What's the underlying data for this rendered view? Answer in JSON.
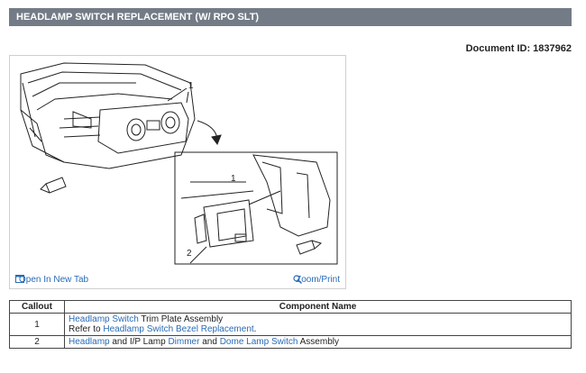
{
  "header": {
    "title": "HEADLAMP SWITCH REPLACEMENT (W/ RPO SLT)"
  },
  "document": {
    "id_label": "Document ID:",
    "id_value": "1837962"
  },
  "figure": {
    "callout_1": "1",
    "callout_inset_1": "1",
    "callout_inset_2": "2",
    "open_tab_label": "Open In New Tab",
    "zoom_label": "Zoom/Print",
    "open_tab_icon": "open-tab-icon",
    "zoom_icon": "magnifier-icon"
  },
  "table": {
    "headers": {
      "callout": "Callout",
      "component": "Component Name"
    },
    "rows": [
      {
        "callout": "1",
        "line1": {
          "link": "Headlamp Switch",
          "text": " Trim Plate Assembly"
        },
        "line2": {
          "prefix": "Refer to ",
          "link": "Headlamp Switch Bezel Replacement",
          "suffix": "."
        }
      },
      {
        "callout": "2",
        "parts": [
          {
            "link": "Headlamp"
          },
          {
            "text": " and I/P Lamp "
          },
          {
            "link": "Dimmer"
          },
          {
            "text": " and "
          },
          {
            "link": "Dome Lamp Switch"
          },
          {
            "text": " Assembly"
          }
        ]
      }
    ]
  }
}
